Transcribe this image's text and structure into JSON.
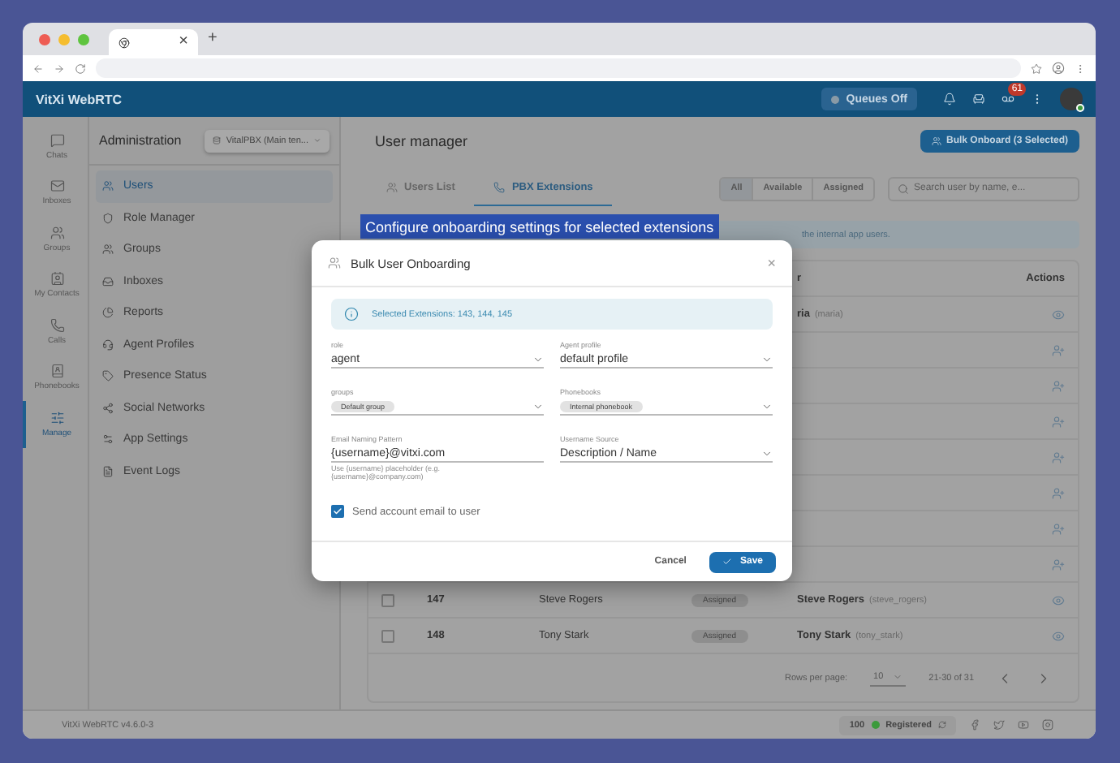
{
  "browser": {
    "tab_close": "×",
    "new_tab": "+"
  },
  "app_header": {
    "title": "VitXi WebRTC",
    "queues": {
      "label": "Queues Off",
      "on": false
    },
    "voicemail_badge": "61"
  },
  "rail": [
    {
      "label": "Chats",
      "selected": false
    },
    {
      "label": "Inboxes",
      "selected": false
    },
    {
      "label": "Groups",
      "selected": false
    },
    {
      "label": "My Contacts",
      "selected": false
    },
    {
      "label": "Calls",
      "selected": false
    },
    {
      "label": "Phonebooks",
      "selected": false
    },
    {
      "label": "Manage",
      "selected": true
    }
  ],
  "sidebar": {
    "title": "Administration",
    "tenant": "VitalPBX (Main ten...",
    "items": [
      {
        "label": "Users",
        "selected": true
      },
      {
        "label": "Role Manager",
        "selected": false
      },
      {
        "label": "Groups",
        "selected": false
      },
      {
        "label": "Inboxes",
        "selected": false
      },
      {
        "label": "Reports",
        "selected": false
      },
      {
        "label": "Agent Profiles",
        "selected": false
      },
      {
        "label": "Presence Status",
        "selected": false
      },
      {
        "label": "Social Networks",
        "selected": false
      },
      {
        "label": "App Settings",
        "selected": false
      },
      {
        "label": "Event Logs",
        "selected": false
      }
    ]
  },
  "main": {
    "title": "User manager",
    "bulk_button": "Bulk Onboard (3 Selected)",
    "tabs": [
      {
        "label": "Users List",
        "selected": false
      },
      {
        "label": "PBX Extensions",
        "selected": true
      }
    ],
    "filters": [
      {
        "label": "All",
        "selected": true
      },
      {
        "label": "Available",
        "selected": false
      },
      {
        "label": "Assigned",
        "selected": false
      }
    ],
    "search": {
      "placeholder": "Search user by name, e..."
    },
    "banner": "the internal app users.",
    "table": {
      "header": {
        "user": "r",
        "actions": "Actions"
      },
      "rows": [
        {
          "kind": "view",
          "user": "ria",
          "username": "(maria)"
        },
        {
          "kind": "add"
        },
        {
          "kind": "add"
        },
        {
          "kind": "add"
        },
        {
          "kind": "add"
        },
        {
          "kind": "add"
        },
        {
          "kind": "add"
        },
        {
          "kind": "add"
        },
        {
          "kind": "view",
          "checked": false,
          "extension": "147",
          "name": "Steve Rogers",
          "status": "Assigned",
          "user": "Steve Rogers",
          "username": "(steve_rogers)"
        },
        {
          "kind": "view",
          "checked": false,
          "extension": "148",
          "name": "Tony Stark",
          "status": "Assigned",
          "user": "Tony Stark",
          "username": "(tony_stark)"
        }
      ]
    },
    "pagination": {
      "rows_label": "Rows per page:",
      "rows_value": "10",
      "range": "21-30 of 31"
    }
  },
  "footer": {
    "version": "VitXi WebRTC v4.6.0-3",
    "extension": "100",
    "status": "Registered",
    "registered": true
  },
  "tooltip": "Configure onboarding settings for selected extensions",
  "dialog": {
    "title": "Bulk User Onboarding",
    "close": "×",
    "info": "Selected Extensions: 143, 144, 145",
    "fields": [
      {
        "kind": "select",
        "label": "role",
        "value": "agent"
      },
      {
        "kind": "select",
        "label": "Agent profile",
        "value": "default profile"
      },
      {
        "kind": "chips",
        "label": "groups",
        "value": "Default group"
      },
      {
        "kind": "chips",
        "label": "Phonebooks",
        "value": "Internal phonebook"
      },
      {
        "kind": "input",
        "label": "Email Naming Pattern",
        "value": "{username}@vitxi.com",
        "helper": "Use {username} placeholder (e.g. {username}@company.com)"
      },
      {
        "kind": "select",
        "label": "Username Source",
        "value": "Description / Name"
      }
    ],
    "send_email": {
      "label": "Send account email to user",
      "checked": true
    },
    "cancel": "Cancel",
    "save": "Save"
  }
}
